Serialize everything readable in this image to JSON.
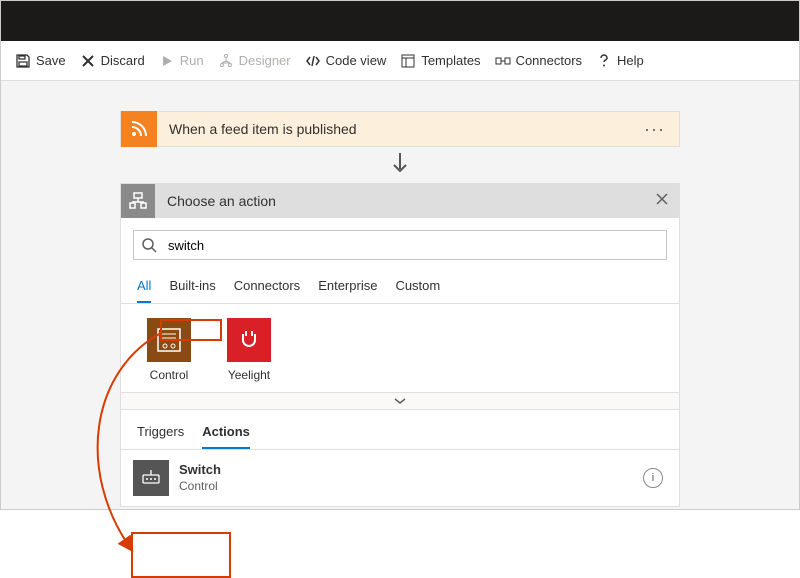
{
  "toolbar": {
    "save": "Save",
    "discard": "Discard",
    "run": "Run",
    "designer": "Designer",
    "codeview": "Code view",
    "templates": "Templates",
    "connectors": "Connectors",
    "help": "Help"
  },
  "trigger": {
    "title": "When a feed item is published"
  },
  "action_panel": {
    "title": "Choose an action",
    "search_value": "switch",
    "category_tabs": [
      "All",
      "Built-ins",
      "Connectors",
      "Enterprise",
      "Custom"
    ],
    "active_category_tab": "All",
    "connectors": [
      {
        "label": "Control",
        "key": "control"
      },
      {
        "label": "Yeelight",
        "key": "yeelight"
      }
    ],
    "result_tabs": [
      "Triggers",
      "Actions"
    ],
    "active_result_tab": "Actions",
    "results": [
      {
        "title": "Switch",
        "subtitle": "Control"
      }
    ]
  }
}
